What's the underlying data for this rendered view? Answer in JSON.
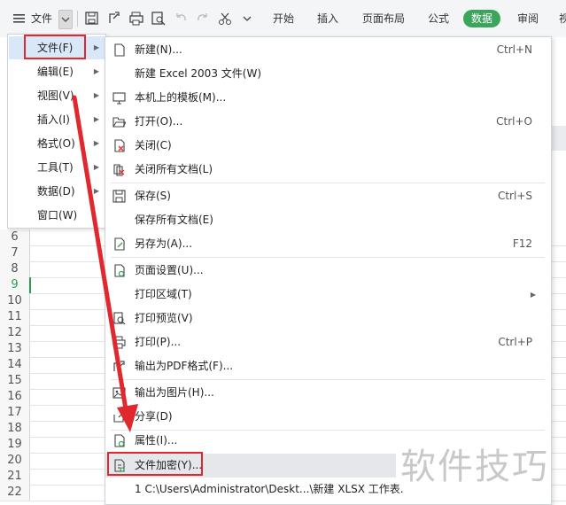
{
  "toolbar": {
    "menu_label": "文件",
    "tabs": [
      "开始",
      "插入",
      "页面布局",
      "公式",
      "数据",
      "审阅",
      "视"
    ],
    "active_tab": "数据"
  },
  "rows": [
    "6",
    "7",
    "8",
    "9",
    "10",
    "11",
    "12",
    "13",
    "14",
    "15",
    "16",
    "17",
    "18",
    "19",
    "20",
    "21",
    "22"
  ],
  "selected_row": "9",
  "file_menu": [
    {
      "label": "文件(F)"
    },
    {
      "label": "编辑(E)"
    },
    {
      "label": "视图(V)"
    },
    {
      "label": "插入(I)"
    },
    {
      "label": "格式(O)"
    },
    {
      "label": "工具(T)"
    },
    {
      "label": "数据(D)"
    },
    {
      "label": "窗口(W)"
    }
  ],
  "submenu": {
    "new": {
      "label": "新建(N)...",
      "shortcut": "Ctrl+N"
    },
    "new_excel2003": {
      "label": "新建 Excel 2003 文件(W)"
    },
    "local_template": {
      "label": "本机上的模板(M)..."
    },
    "open": {
      "label": "打开(O)...",
      "shortcut": "Ctrl+O"
    },
    "close": {
      "label": "关闭(C)"
    },
    "close_all": {
      "label": "关闭所有文档(L)"
    },
    "save": {
      "label": "保存(S)",
      "shortcut": "Ctrl+S"
    },
    "save_all": {
      "label": "保存所有文档(E)"
    },
    "save_as": {
      "label": "另存为(A)...",
      "shortcut": "F12"
    },
    "page_setup": {
      "label": "页面设置(U)..."
    },
    "print_area": {
      "label": "打印区域(T)"
    },
    "print_preview": {
      "label": "打印预览(V)"
    },
    "print": {
      "label": "打印(P)...",
      "shortcut": "Ctrl+P"
    },
    "export_pdf": {
      "label": "输出为PDF格式(F)..."
    },
    "export_image": {
      "label": "输出为图片(H)..."
    },
    "share": {
      "label": "分享(D)"
    },
    "properties": {
      "label": "属性(I)..."
    },
    "encrypt": {
      "label": "文件加密(Y)..."
    },
    "recent": {
      "label": "1 C:\\Users\\Administrator\\Deskt...\\新建 XLSX 工作表."
    }
  },
  "watermark": "软件技巧",
  "colors": {
    "accent_green": "#3ca55c",
    "highlight_red": "#e0282e"
  }
}
